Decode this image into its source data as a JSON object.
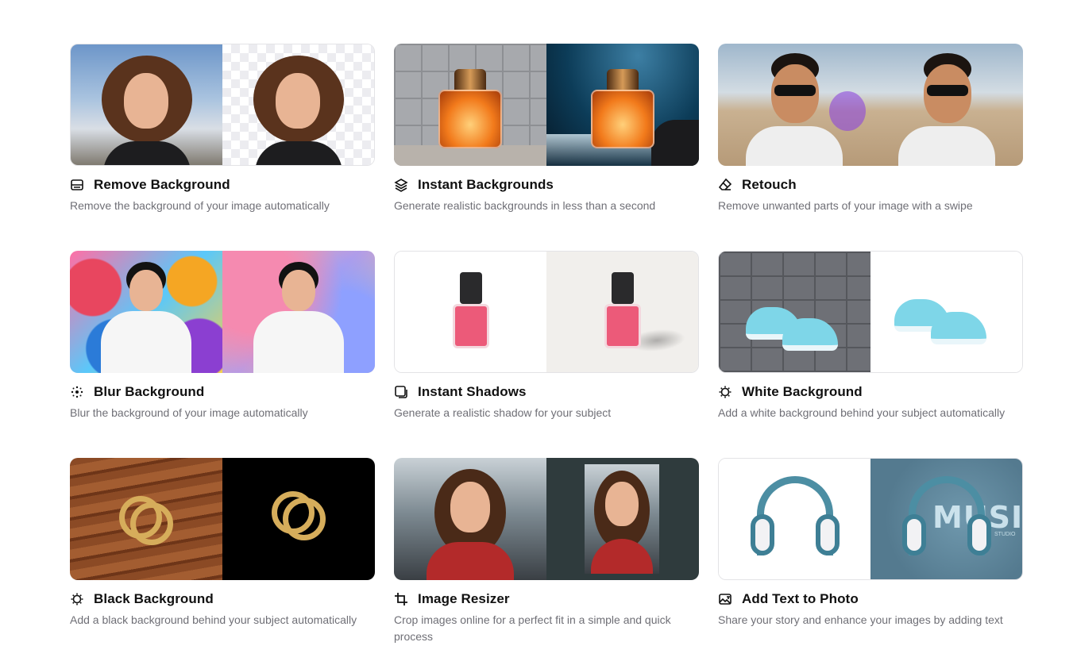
{
  "tools": [
    {
      "title": "Remove Background",
      "description": "Remove the background of your image automatically",
      "icon": "remove-background-icon"
    },
    {
      "title": "Instant Backgrounds",
      "description": "Generate realistic backgrounds in less than a second",
      "icon": "layers-icon"
    },
    {
      "title": "Retouch",
      "description": "Remove unwanted parts of your image with a swipe",
      "icon": "eraser-icon"
    },
    {
      "title": "Blur Background",
      "description": "Blur the background of your image automatically",
      "icon": "blur-dots-icon"
    },
    {
      "title": "Instant Shadows",
      "description": "Generate a realistic shadow for your subject",
      "icon": "shadow-square-icon"
    },
    {
      "title": "White Background",
      "description": "Add a white background behind your subject automatically",
      "icon": "sun-badge-icon"
    },
    {
      "title": "Black Background",
      "description": "Add a black background behind your subject automatically",
      "icon": "sun-badge-icon"
    },
    {
      "title": "Image Resizer",
      "description": "Crop images online for a perfect fit in a simple and quick process",
      "icon": "crop-icon"
    },
    {
      "title": "Add Text to Photo",
      "description": "Share your story and enhance your images by adding text",
      "icon": "image-text-icon"
    }
  ],
  "thumbnail_text": {
    "music": "MUSIC",
    "studio": "STUDIO"
  }
}
